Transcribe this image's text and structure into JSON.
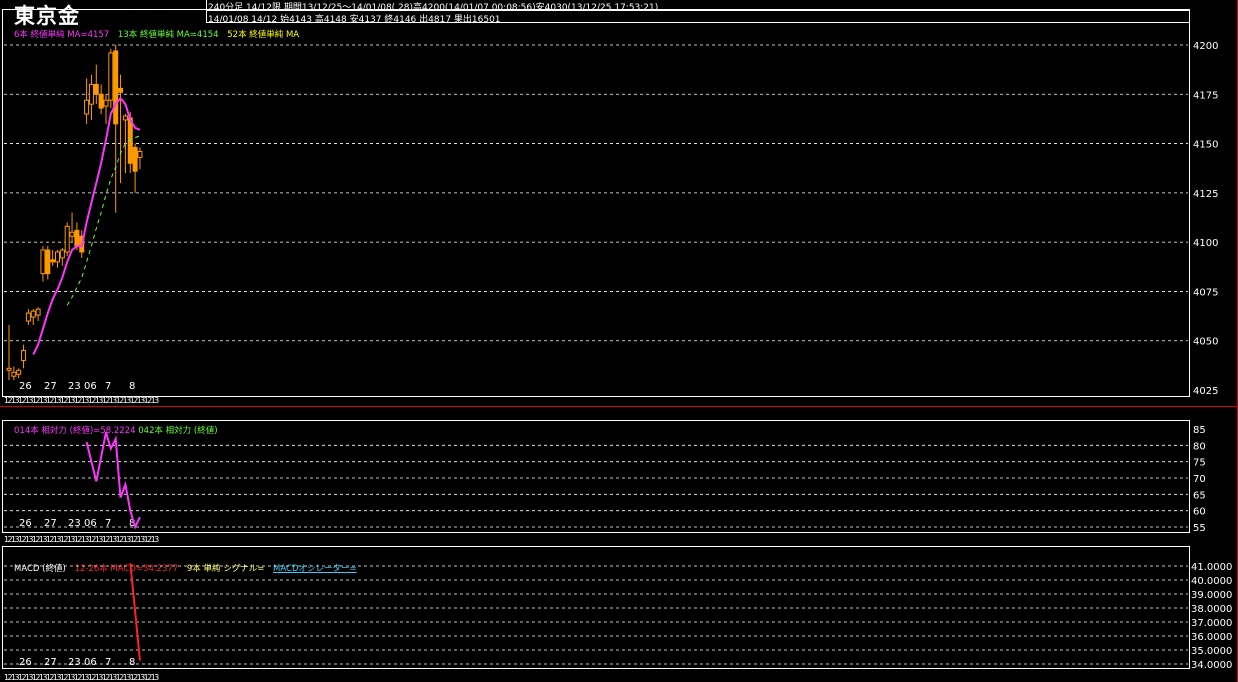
{
  "header": {
    "title": "東京金",
    "info_line1": "240分足 14/12限 期間13/12/25～14/01/08( 28)高4200(14/01/07 00:08:56)安4030(13/12/25 17:53:21)",
    "info_line2": "14/01/08 14/12 始4143 高4148 安4137 終4146 出4817 果出16501"
  },
  "colors": {
    "bg": "#000000",
    "grid": "#ffffff",
    "candle": "#ff9900",
    "ma6": "#ff33ff",
    "ma13": "#66ff33",
    "ma52": "#ffff00",
    "rsi": "#ff33ff",
    "macd": "#ff2222",
    "macd_signal": "#ffff66",
    "oscillator": "#33ccff",
    "separator": "#cc0000"
  },
  "price_legend": {
    "ma6": "6本 終値単純 MA=4157",
    "ma13": "13本 終値単純 MA=4154",
    "ma52": "52本 終値単純 MA"
  },
  "rsi_legend": {
    "rsi14": "014本 相対力 (終値)=58.2224",
    "rsi42": "042本 相対力 (終値)"
  },
  "macd_legend": {
    "name": "MACD (終値)",
    "macd": "12-26本 MACD=34.2377",
    "signal": "9本 単純 シグナル=",
    "osc": "MACDオシレーター="
  },
  "x_day_labels": [
    "26",
    "27",
    "2",
    "3",
    "06",
    "7",
    "8"
  ],
  "x_date_strip": "12131213121312131213121312131213121312131213",
  "chart_data": [
    {
      "type": "candlestick",
      "title": "東京金",
      "ylim": [
        4025,
        4212
      ],
      "y_ticks": [
        4200,
        4175,
        4150,
        4125,
        4100,
        4075,
        4050,
        4025
      ],
      "candles": [
        {
          "o": 4035,
          "h": 4058,
          "l": 4030,
          "c": 4036
        },
        {
          "o": 4032,
          "h": 4037,
          "l": 4030,
          "c": 4034
        },
        {
          "o": 4033,
          "h": 4036,
          "l": 4031,
          "c": 4035
        },
        {
          "o": 4040,
          "h": 4048,
          "l": 4036,
          "c": 4045
        },
        {
          "o": 4060,
          "h": 4066,
          "l": 4058,
          "c": 4064
        },
        {
          "o": 4062,
          "h": 4066,
          "l": 4058,
          "c": 4065
        },
        {
          "o": 4063,
          "h": 4067,
          "l": 4060,
          "c": 4066
        },
        {
          "o": 4084,
          "h": 4098,
          "l": 4080,
          "c": 4096
        },
        {
          "o": 4096,
          "h": 4098,
          "l": 4081,
          "c": 4084
        },
        {
          "o": 4091,
          "h": 4096,
          "l": 4088,
          "c": 4090
        },
        {
          "o": 4090,
          "h": 4096,
          "l": 4087,
          "c": 4095
        },
        {
          "o": 4092,
          "h": 4097,
          "l": 4088,
          "c": 4096
        },
        {
          "o": 4095,
          "h": 4110,
          "l": 4093,
          "c": 4108
        },
        {
          "o": 4103,
          "h": 4115,
          "l": 4100,
          "c": 4105
        },
        {
          "o": 4106,
          "h": 4110,
          "l": 4096,
          "c": 4098
        },
        {
          "o": 4103,
          "h": 4106,
          "l": 4092,
          "c": 4095
        },
        {
          "o": 4165,
          "h": 4183,
          "l": 4160,
          "c": 4172
        },
        {
          "o": 4170,
          "h": 4185,
          "l": 4162,
          "c": 4180
        },
        {
          "o": 4180,
          "h": 4190,
          "l": 4170,
          "c": 4175
        },
        {
          "o": 4175,
          "h": 4180,
          "l": 4165,
          "c": 4168
        },
        {
          "o": 4169,
          "h": 4175,
          "l": 4160,
          "c": 4172
        },
        {
          "o": 4172,
          "h": 4198,
          "l": 4168,
          "c": 4196
        },
        {
          "o": 4197,
          "h": 4200,
          "l": 4115,
          "c": 4160
        },
        {
          "o": 4178,
          "h": 4185,
          "l": 4130,
          "c": 4176
        },
        {
          "o": 4162,
          "h": 4165,
          "l": 4135,
          "c": 4164
        },
        {
          "o": 4163,
          "h": 4166,
          "l": 4135,
          "c": 4140
        },
        {
          "o": 4148,
          "h": 4150,
          "l": 4125,
          "c": 4136
        },
        {
          "o": 4143,
          "h": 4148,
          "l": 4137,
          "c": 4146
        }
      ],
      "ma6": [
        null,
        null,
        null,
        null,
        null,
        4043,
        4048,
        4056,
        4064,
        4071,
        4076,
        4082,
        4090,
        4096,
        4098,
        4098,
        4110,
        4120,
        4130,
        4140,
        4152,
        4165,
        4170,
        4173,
        4170,
        4162,
        4158,
        4157
      ],
      "ma13": [
        null,
        null,
        null,
        null,
        null,
        null,
        null,
        null,
        null,
        null,
        null,
        null,
        4068,
        4072,
        4077,
        4082,
        4090,
        4098,
        4107,
        4115,
        4124,
        4132,
        4138,
        4145,
        4150,
        4152,
        4153,
        4154
      ]
    },
    {
      "type": "line",
      "title": "014本 相対力 (終値)",
      "ylim": [
        55,
        85
      ],
      "y_ticks": [
        85,
        80,
        75,
        70,
        65,
        60,
        55
      ],
      "series": [
        {
          "name": "014本 相対力 (終値)",
          "x_index": [
            16,
            18,
            20,
            21,
            22,
            23,
            24,
            25,
            26,
            27
          ],
          "values": [
            81,
            69,
            84,
            79,
            82,
            64,
            68,
            60,
            55,
            58
          ]
        }
      ]
    },
    {
      "type": "line",
      "title": "MACD (終値)",
      "ylim": [
        34.0,
        41.0
      ],
      "y_ticks": [
        "41.0000",
        "40.0000",
        "39.0000",
        "38.0000",
        "37.0000",
        "36.0000",
        "35.0000",
        "34.0000"
      ],
      "series": [
        {
          "name": "12-26本 MACD",
          "x_index": [
            25,
            26,
            27
          ],
          "values": [
            41.2,
            37.8,
            34.2377
          ]
        }
      ]
    }
  ]
}
